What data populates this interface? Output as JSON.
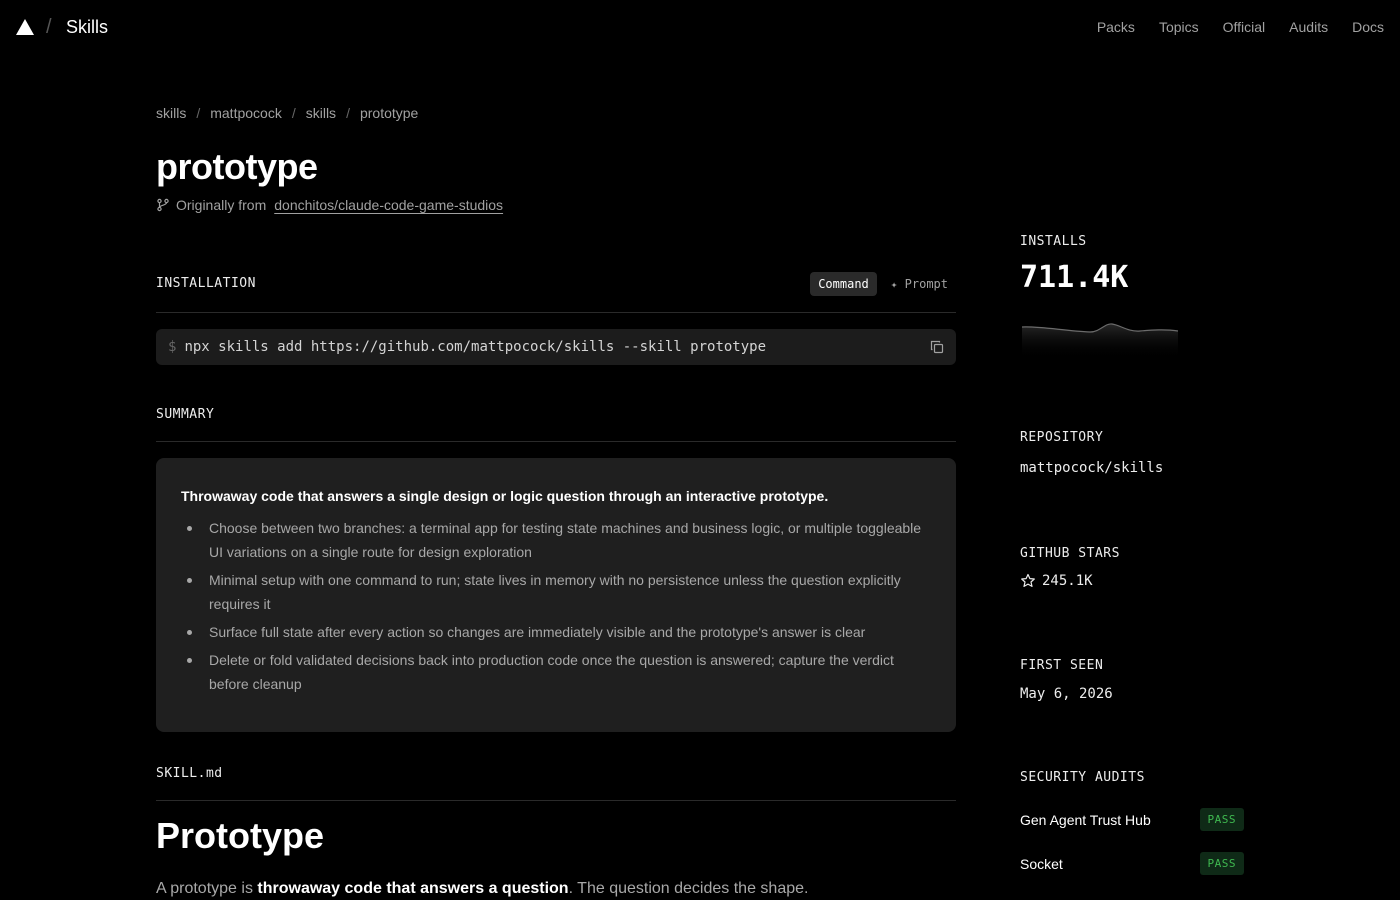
{
  "header": {
    "brand": "Skills",
    "nav": [
      "Packs",
      "Topics",
      "Official",
      "Audits",
      "Docs"
    ]
  },
  "breadcrumb": [
    "skills",
    "mattpocock",
    "skills",
    "prototype"
  ],
  "page": {
    "title": "prototype",
    "origin_prefix": "Originally from",
    "origin_link": "donchitos/claude-code-game-studios"
  },
  "installation": {
    "label": "INSTALLATION",
    "tabs": {
      "command": "Command",
      "prompt": "Prompt"
    },
    "prompt_symbol": "$",
    "command": "npx skills add https://github.com/mattpocock/skills --skill prototype"
  },
  "summary": {
    "label": "SUMMARY",
    "lead": "Throwaway code that answers a single design or logic question through an interactive prototype.",
    "items": [
      "Choose between two branches: a terminal app for testing state machines and business logic, or multiple toggleable UI variations on a single route for design exploration",
      "Minimal setup with one command to run; state lives in memory with no persistence unless the question explicitly requires it",
      "Surface full state after every action so changes are immediately visible and the prototype's answer is clear",
      "Delete or fold validated decisions back into production code once the question is answered; capture the verdict before cleanup"
    ]
  },
  "skillmd": {
    "label": "SKILL.md",
    "heading": "Prototype",
    "para_pre": "A prototype is ",
    "para_bold": "throwaway code that answers a question",
    "para_post": ". The question decides the shape."
  },
  "sidebar": {
    "installs_label": "INSTALLS",
    "installs_value": "711.4K",
    "repo_label": "REPOSITORY",
    "repo_value": "mattpocock/skills",
    "stars_label": "GITHUB STARS",
    "stars_value": "245.1K",
    "first_seen_label": "FIRST SEEN",
    "first_seen_value": "May 6, 2026",
    "audits_label": "SECURITY AUDITS",
    "audits": [
      {
        "name": "Gen Agent Trust Hub",
        "status": "PASS"
      },
      {
        "name": "Socket",
        "status": "PASS"
      }
    ]
  },
  "colors": {
    "background": "#000000",
    "pass_green": "#3fb950"
  }
}
